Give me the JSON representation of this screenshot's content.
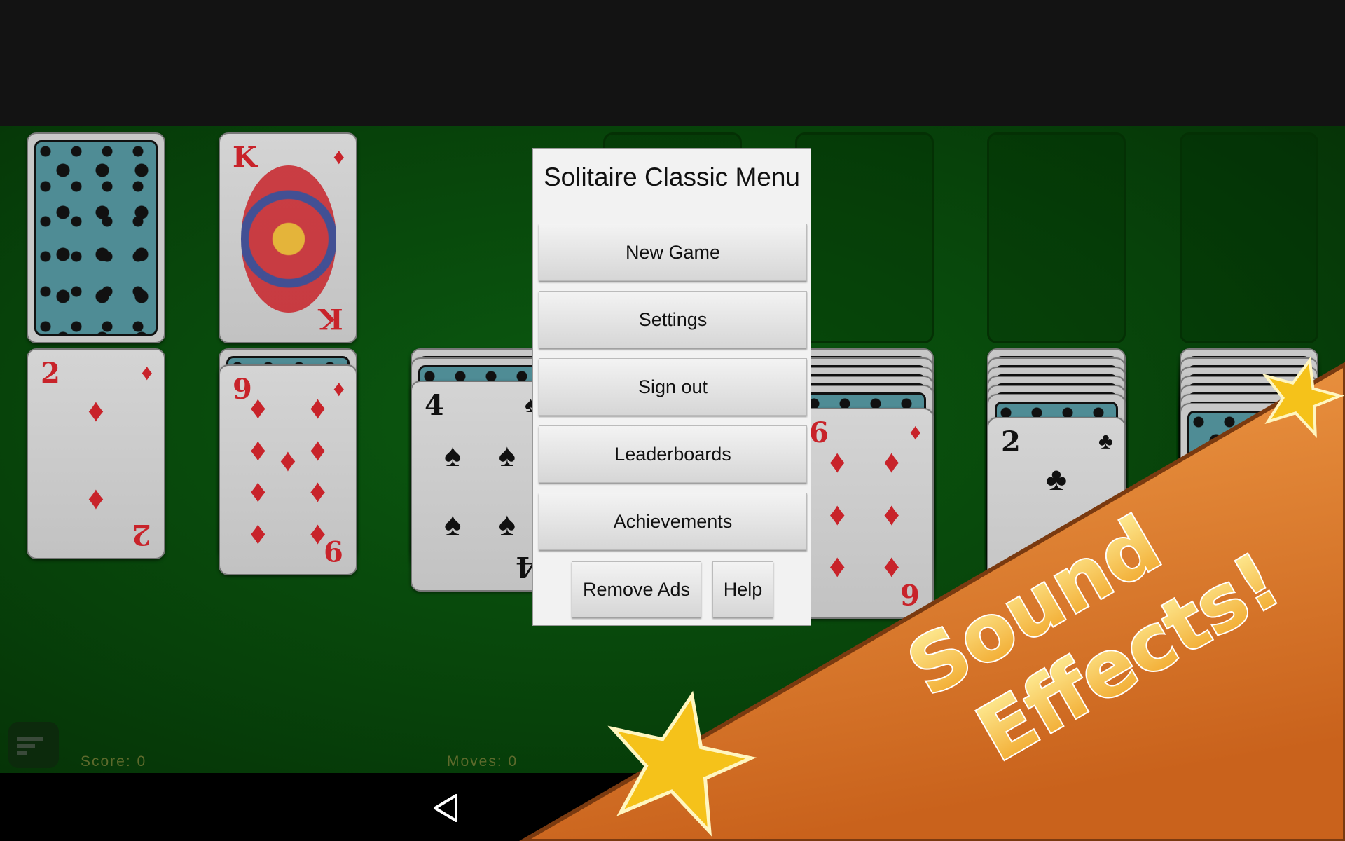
{
  "menu": {
    "title": "Solitaire Classic Menu",
    "buttons": [
      "New Game",
      "Settings",
      "Sign out",
      "Leaderboards",
      "Achievements"
    ],
    "remove_ads": "Remove Ads",
    "help": "Help"
  },
  "status": {
    "score": "Score: 0",
    "moves": "Moves: 0"
  },
  "banner": {
    "line1": "Sound",
    "line2": "Effects!"
  },
  "waste": {
    "rank": "K",
    "suit": "♦",
    "color": "red"
  },
  "tableau": [
    {
      "hidden": 0,
      "rank": "2",
      "suit": "♦",
      "color": "red"
    },
    {
      "hidden": 1,
      "rank": "9",
      "suit": "♦",
      "color": "red"
    },
    {
      "hidden": 2,
      "rank": "4",
      "suit": "♠",
      "color": "blk"
    },
    {
      "hidden": 3,
      "rank": "",
      "suit": "",
      "color": "blk"
    },
    {
      "hidden": 5,
      "rank": "6",
      "suit": "♦",
      "color": "red"
    },
    {
      "hidden": 6,
      "rank": "2",
      "suit": "♣",
      "color": "blk"
    },
    {
      "hidden": 7,
      "rank": "",
      "suit": "",
      "color": "blk"
    }
  ],
  "colors": {
    "felt": "#07420a",
    "banner": "#e07f2c",
    "star": "#f5c21a"
  }
}
